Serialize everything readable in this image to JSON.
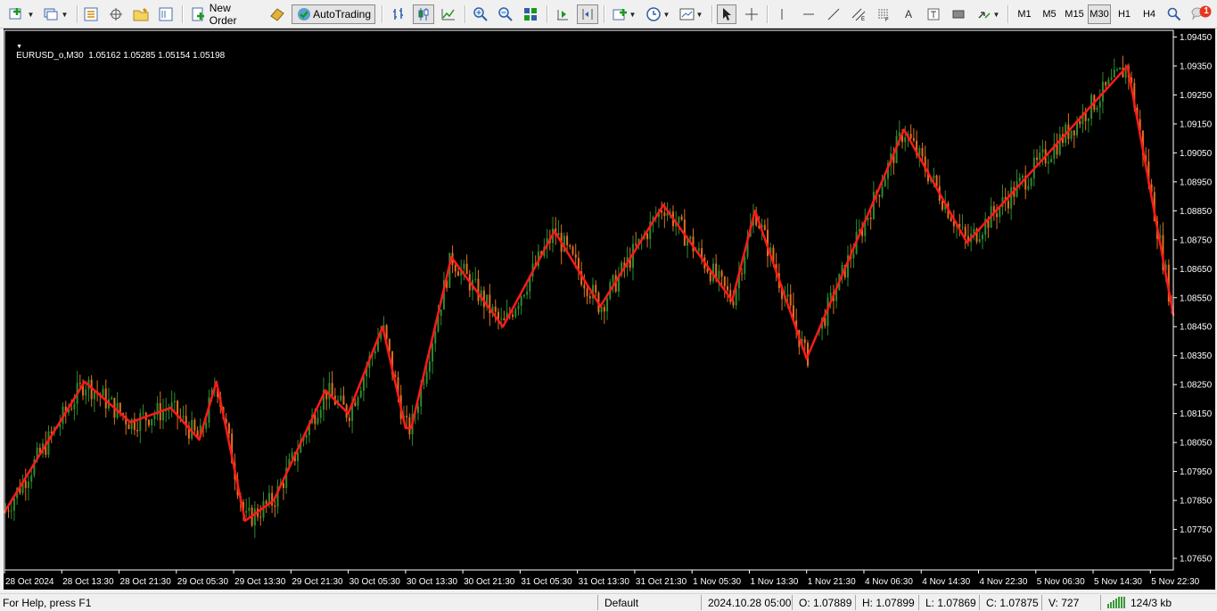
{
  "toolbar": {
    "new_order_label": "New Order",
    "autotrading_label": "AutoTrading",
    "timeframes": [
      "M1",
      "M5",
      "M15",
      "M30",
      "H1",
      "H4"
    ],
    "active_timeframe": "M30",
    "text_tool_label": "A",
    "notification_count": "1"
  },
  "chart": {
    "header": "EURUSD_o,M30  1.05162 1.05285 1.05154 1.05198",
    "background": "#000000",
    "bull_color": "#2e8b2e",
    "bear_color": "#e07020",
    "zigzag_color": "#ff1a1a",
    "axis_text_color": "#ffffff"
  },
  "chart_data": {
    "type": "line",
    "symbol": "EURUSD_o",
    "timeframe": "M30",
    "ylim": [
      1.0761,
      1.0947
    ],
    "y_ticks": [
      "1.09450",
      "1.09350",
      "1.09250",
      "1.09150",
      "1.09050",
      "1.08950",
      "1.08850",
      "1.08750",
      "1.08650",
      "1.08550",
      "1.08450",
      "1.08350",
      "1.08250",
      "1.08150",
      "1.08050",
      "1.07950",
      "1.07850",
      "1.07750",
      "1.07650"
    ],
    "x_ticks": [
      "28 Oct 2024",
      "28 Oct 13:30",
      "28 Oct 21:30",
      "29 Oct 05:30",
      "29 Oct 13:30",
      "29 Oct 21:30",
      "30 Oct 05:30",
      "30 Oct 13:30",
      "30 Oct 21:30",
      "31 Oct 05:30",
      "31 Oct 13:30",
      "31 Oct 21:30",
      "1 Nov 05:30",
      "1 Nov 13:30",
      "1 Nov 21:30",
      "4 Nov 06:30",
      "4 Nov 14:30",
      "4 Nov 22:30",
      "5 Nov 06:30",
      "5 Nov 14:30",
      "5 Nov 22:30"
    ],
    "x_range": [
      0,
      20.4
    ],
    "series": [
      {
        "style": "zigzag",
        "x": [
          0,
          1.4,
          2.2,
          2.9,
          3.4,
          3.7,
          4.2,
          4.7,
          5.6,
          6.0,
          6.6,
          7.0,
          7.1,
          7.8,
          8.7,
          9.6,
          10.4,
          11.5,
          12.7,
          13.1,
          14.0,
          15.7,
          16.8,
          19.6,
          20.4
        ],
        "y": [
          1.0781,
          1.0826,
          1.0812,
          1.0817,
          1.0806,
          1.0826,
          1.0778,
          1.0785,
          1.0823,
          1.0815,
          1.0845,
          1.081,
          1.081,
          1.0869,
          1.0845,
          1.0878,
          1.0852,
          1.0887,
          1.0854,
          1.0885,
          1.0834,
          1.0913,
          1.0874,
          1.0935,
          1.0849
        ]
      }
    ]
  },
  "status": {
    "help": "For Help, press F1",
    "profile": "Default",
    "datetime": "2024.10.28 05:00",
    "open": "O: 1.07889",
    "high": "H: 1.07899",
    "low": "L: 1.07869",
    "close": "C: 1.07875",
    "volume": "V: 727",
    "traffic": "124/3 kb"
  }
}
